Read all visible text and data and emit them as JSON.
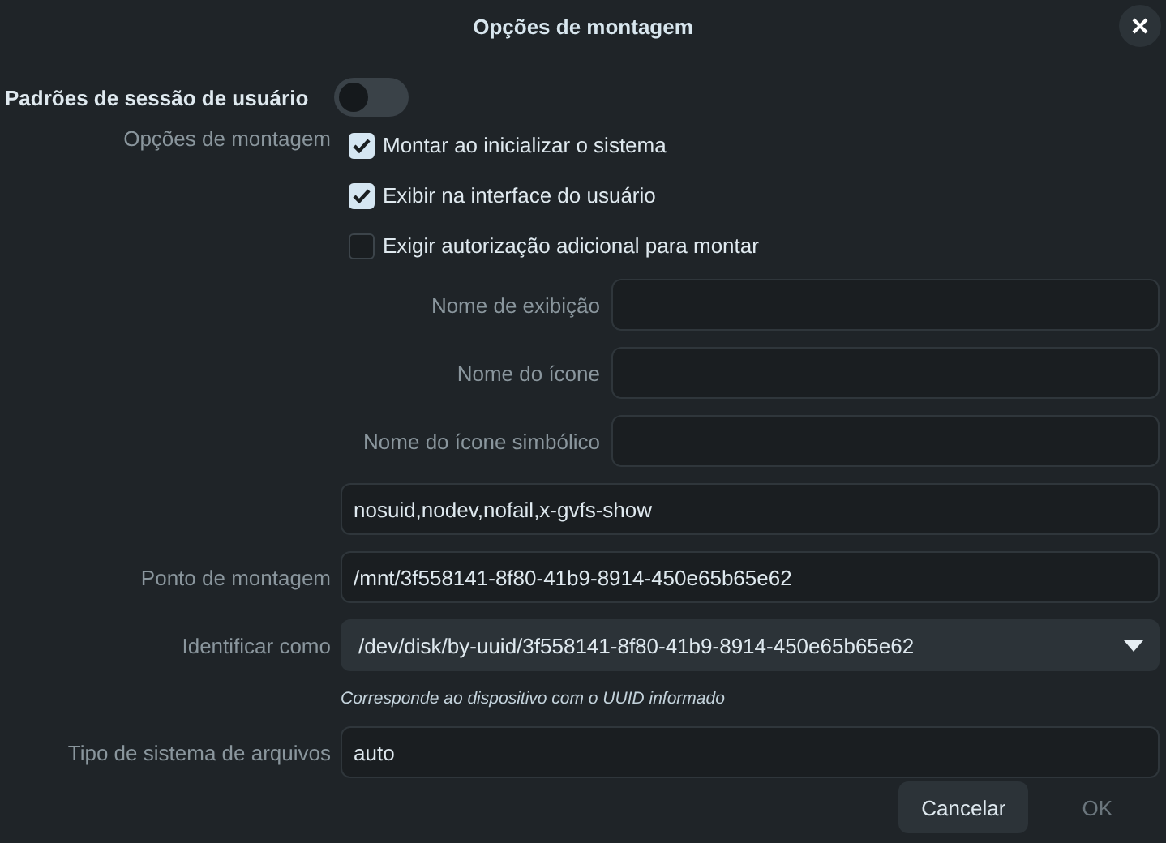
{
  "title": "Opções de montagem",
  "session_defaults": {
    "label": "Padrões de sessão de usuário",
    "on": false
  },
  "mount_options": {
    "label": "Opções de montagem",
    "options": [
      {
        "label": "Montar ao inicializar o sistema",
        "checked": true
      },
      {
        "label": "Exibir na interface do usuário",
        "checked": true
      },
      {
        "label": "Exigir autorização adicional para montar",
        "checked": false
      }
    ]
  },
  "name_fields": [
    {
      "label": "Nome de exibição"
    },
    {
      "label": "Nome do ícone"
    },
    {
      "label": "Nome do ícone simbólico"
    }
  ],
  "options_field": {
    "value": "nosuid,nodev,nofail,x-gvfs-show"
  },
  "mount_point": {
    "label": "Ponto de montagem",
    "value": "/mnt/3f558141-8f80-41b9-8914-450e65b65e62"
  },
  "identify_as": {
    "label": "Identificar como",
    "value": "/dev/disk/by-uuid/3f558141-8f80-41b9-8914-450e65b65e62",
    "hint": "Corresponde ao dispositivo com o UUID informado"
  },
  "filesystem_type": {
    "label": "Tipo de sistema de arquivos",
    "value": "auto"
  },
  "buttons": [
    {
      "label": "Cancelar",
      "disabled": false
    },
    {
      "label": "OK",
      "disabled": true
    }
  ]
}
